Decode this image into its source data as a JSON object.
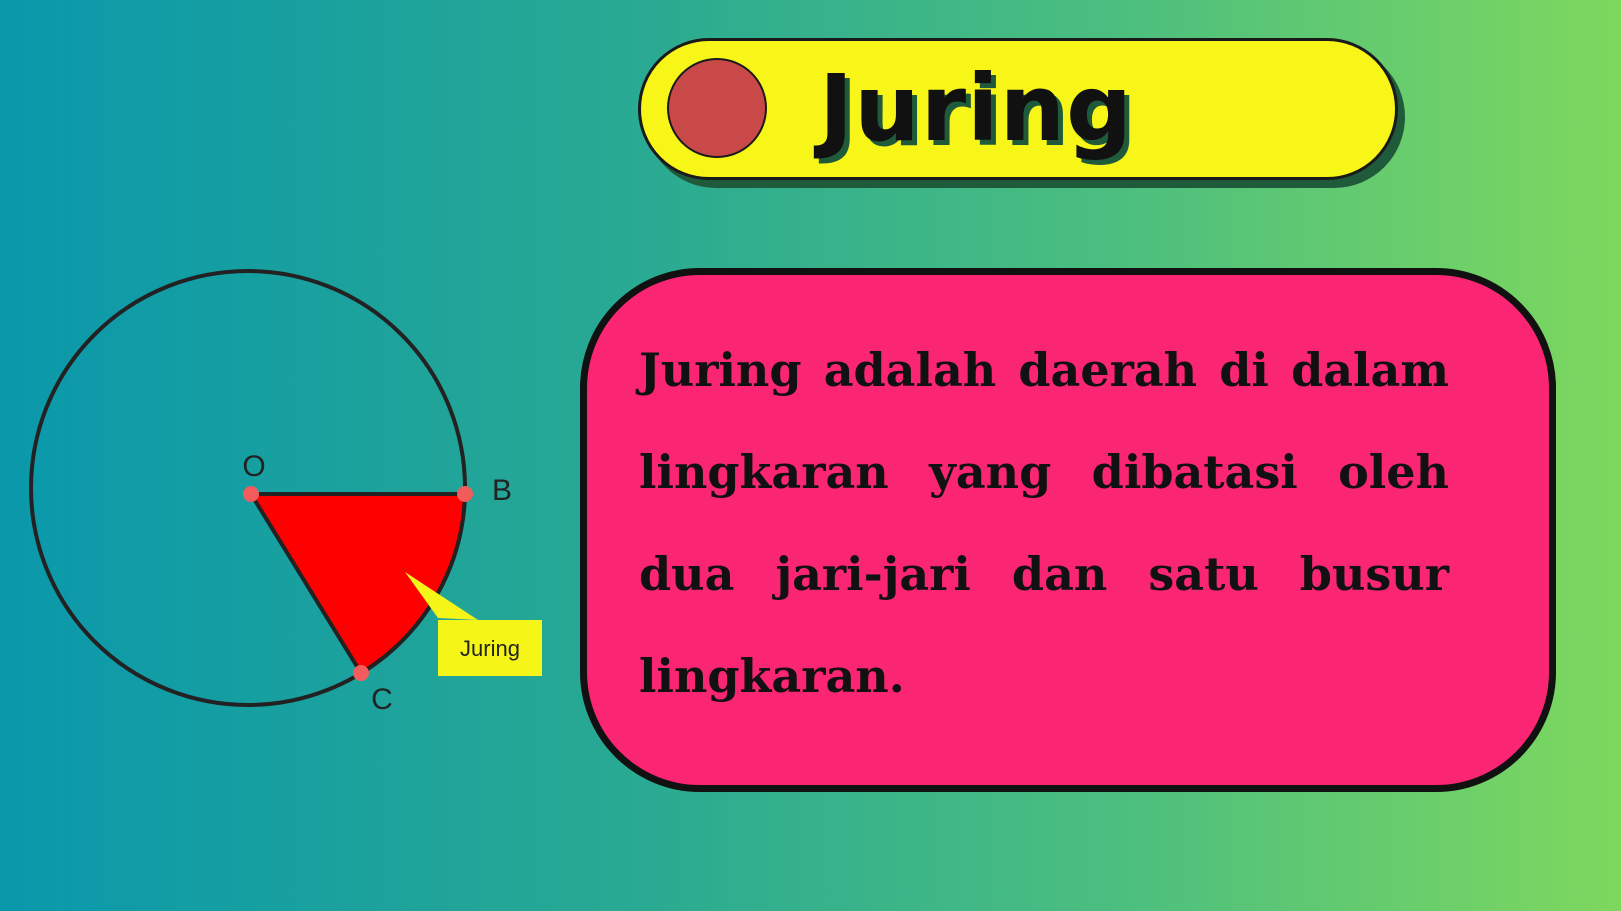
{
  "title": "Juring",
  "diagram": {
    "labels": {
      "center": "O",
      "point_b": "B",
      "point_c": "C",
      "sector_callout": "Juring"
    },
    "colors": {
      "sector": "#ff0000",
      "points": "#f25c5c",
      "callout": "#f5f518"
    }
  },
  "definition": "Juring adalah daerah di dalam lingkaran yang dibatasi oleh dua jari-jari dan satu busur lingkaran.",
  "colors": {
    "title_bar": "#f8f518",
    "title_dot": "#c94848",
    "card": "#fa2573"
  }
}
